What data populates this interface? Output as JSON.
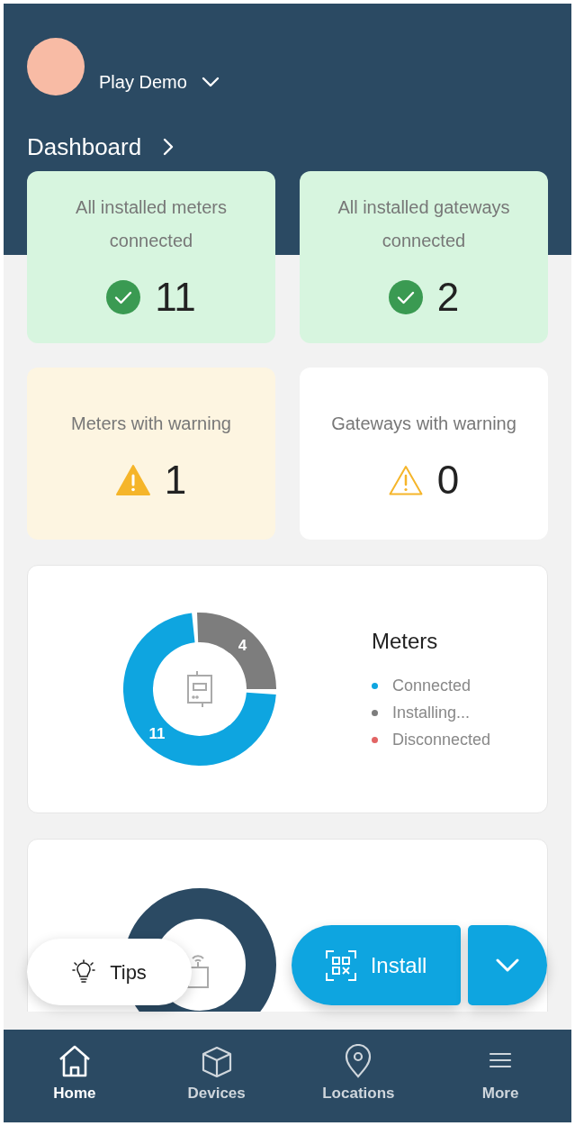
{
  "account": {
    "name": "Play Demo"
  },
  "title": "Dashboard",
  "tiles": [
    {
      "label": "All installed meters connected",
      "count": "11",
      "kind": "ok"
    },
    {
      "label": "All installed gateways connected",
      "count": "2",
      "kind": "ok"
    },
    {
      "label": "Meters with warning",
      "count": "1",
      "kind": "alert"
    },
    {
      "label": "Gateways with warning",
      "count": "0",
      "kind": "clear"
    }
  ],
  "meters_card": {
    "title": "Meters",
    "legend": [
      {
        "color": "#0ea5e0"
      },
      {
        "color": "#7d7d7d"
      },
      {
        "color": "#e26464"
      }
    ],
    "chart_data": {
      "type": "donut",
      "categories": [
        "Connected",
        "Installing...",
        "Disconnected"
      ],
      "values": [
        11,
        4,
        0
      ],
      "value_labels": [
        "11",
        "4",
        null
      ]
    }
  },
  "tips_button": {
    "label": "Tips"
  },
  "install_button": {
    "label": "Install"
  },
  "nav": [
    {
      "label": "Home",
      "selected": true
    },
    {
      "label": "Devices",
      "selected": false
    },
    {
      "label": "Locations",
      "selected": false
    },
    {
      "label": "More",
      "selected": false
    }
  ]
}
